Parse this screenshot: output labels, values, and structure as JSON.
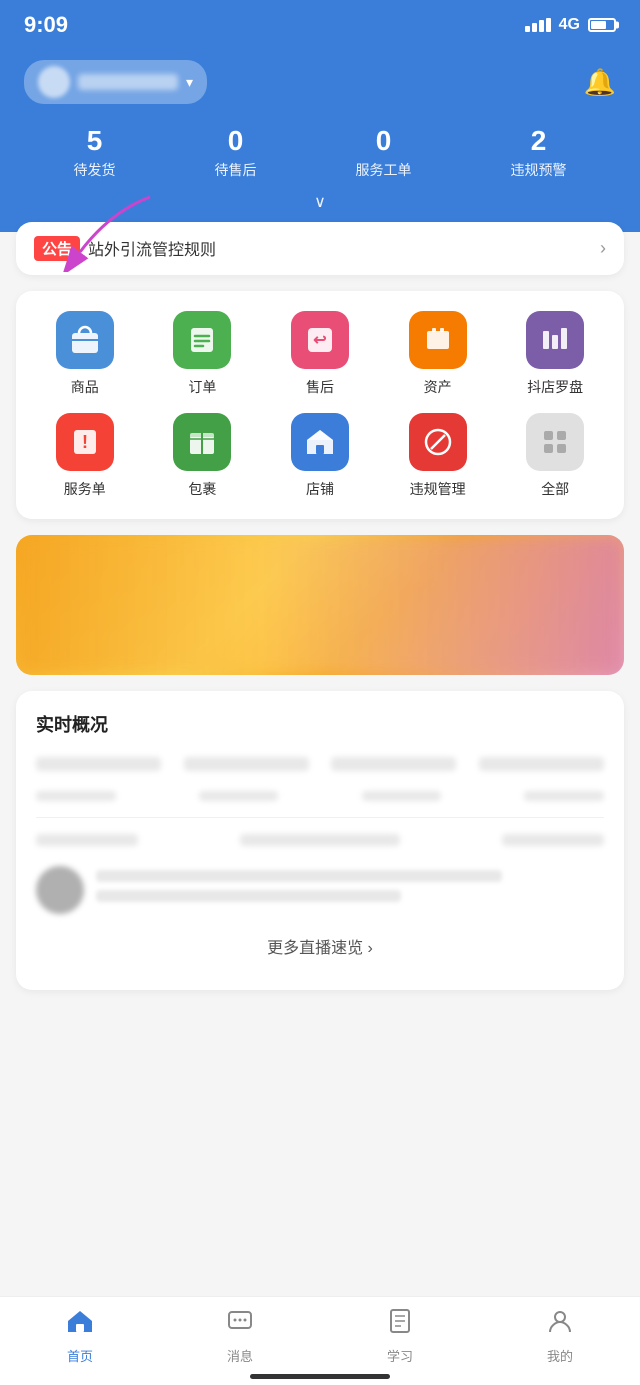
{
  "statusBar": {
    "time": "9:09",
    "signal": "4G"
  },
  "header": {
    "storeName": "店铺名称",
    "bellLabel": "通知"
  },
  "stats": [
    {
      "key": "待发货",
      "value": "5"
    },
    {
      "key": "待售后",
      "value": "0"
    },
    {
      "key": "服务工单",
      "value": "0"
    },
    {
      "key": "违规预警",
      "value": "2"
    }
  ],
  "announcement": {
    "badge": "公告",
    "text": "站外引流管控规则",
    "arrow": "›"
  },
  "iconGrid": [
    {
      "key": "商品",
      "label": "商品",
      "color": "blue",
      "icon": "🛍"
    },
    {
      "key": "订单",
      "label": "订单",
      "color": "green",
      "icon": "≡"
    },
    {
      "key": "售后",
      "label": "售后",
      "color": "pink",
      "icon": "↩"
    },
    {
      "key": "资产",
      "label": "资产",
      "color": "orange",
      "icon": "💼"
    },
    {
      "key": "抖店罗盘",
      "label": "抖店罗盘",
      "color": "purple",
      "icon": "📊"
    },
    {
      "key": "服务单",
      "label": "服务单",
      "color": "red",
      "icon": "!"
    },
    {
      "key": "包裹",
      "label": "包裹",
      "color": "green2",
      "icon": "📦"
    },
    {
      "key": "店铺",
      "label": "店铺",
      "color": "blue2",
      "icon": "🏠"
    },
    {
      "key": "违规管理",
      "label": "违规管理",
      "color": "pinkred",
      "icon": "⊘"
    },
    {
      "key": "全部",
      "label": "全部",
      "color": "gray",
      "icon": "⊞"
    }
  ],
  "realtimeSection": {
    "title": "实时概况",
    "moreLive": "更多直播速览 ›"
  },
  "bottomNav": [
    {
      "key": "home",
      "label": "首页",
      "active": true
    },
    {
      "key": "message",
      "label": "消息",
      "active": false
    },
    {
      "key": "learn",
      "label": "学习",
      "active": false
    },
    {
      "key": "mine",
      "label": "我的",
      "active": false
    }
  ]
}
